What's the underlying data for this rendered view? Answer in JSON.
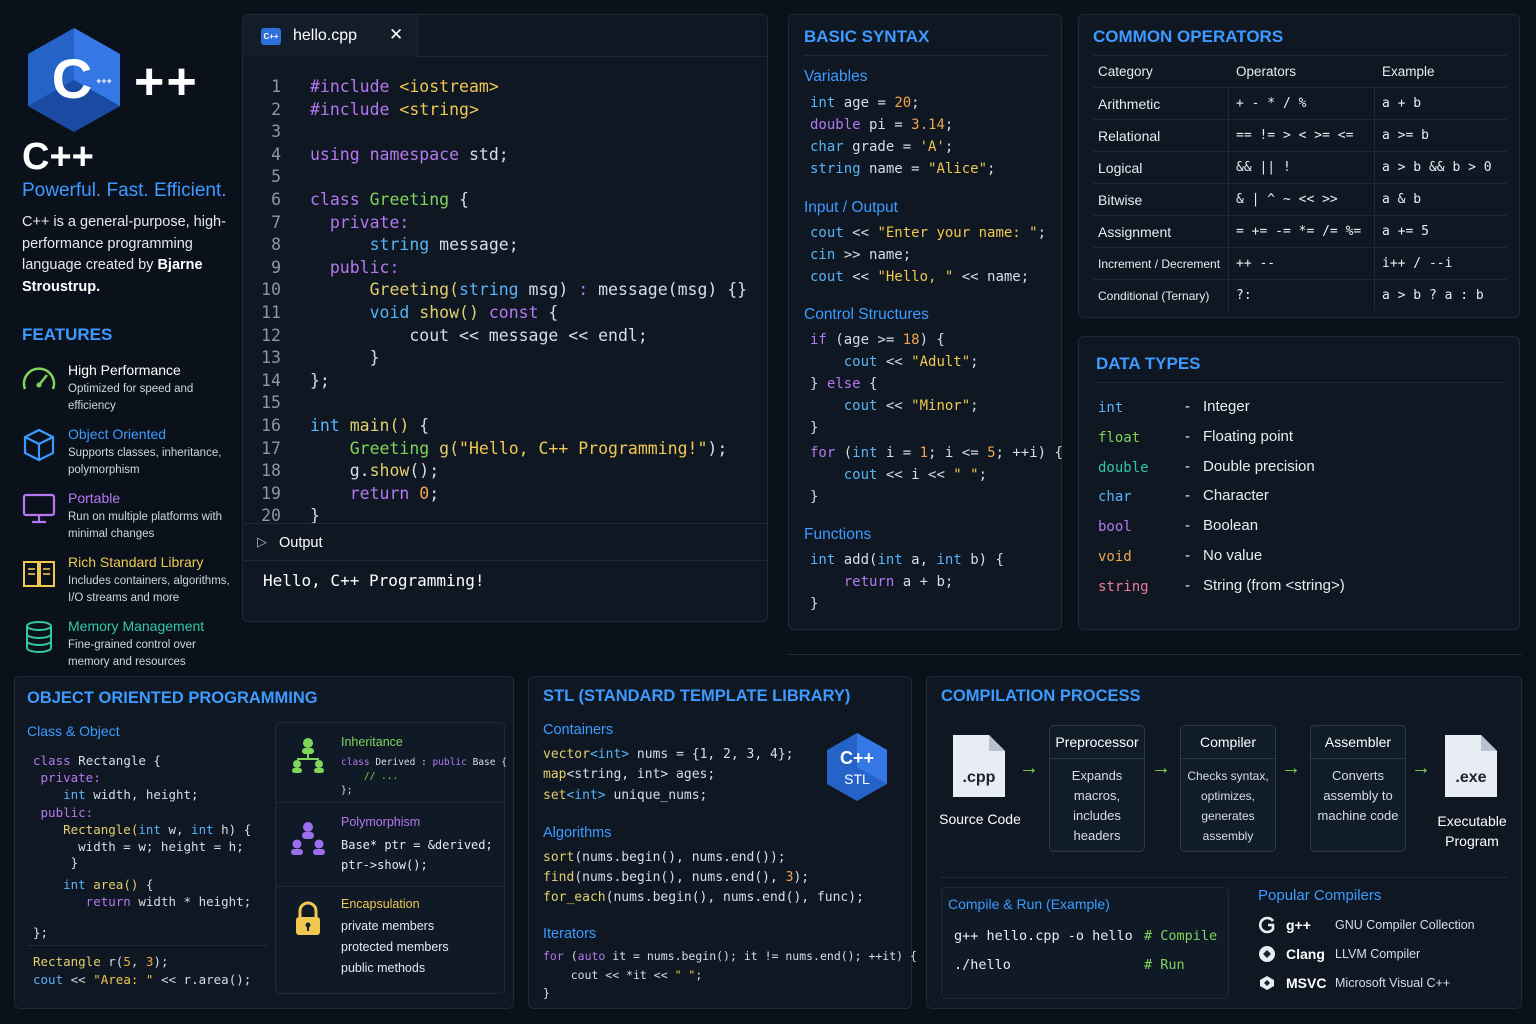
{
  "brand": {
    "plusplus": "++",
    "logo_text": "C",
    "logo_small": "+++",
    "title": "C++",
    "tagline": "Powerful. Fast. Efficient.",
    "intro": "C++ is a general-purpose, high-performance programming language created by",
    "intro_author": "Bjarne Stroustrup."
  },
  "features": {
    "title": "FEATURES",
    "items": [
      {
        "title": "High Performance",
        "desc": "Optimized for speed and efficiency",
        "color": "#7fd65a",
        "icon": "speedometer-icon"
      },
      {
        "title": "Object Oriented",
        "desc": "Supports classes, inheritance, polymorphism",
        "color": "#3d9bff",
        "icon": "cube-icon"
      },
      {
        "title": "Portable",
        "desc": "Run on multiple platforms with minimal changes",
        "color": "#b678f0",
        "icon": "monitor-icon"
      },
      {
        "title": "Rich Standard Library",
        "desc": "Includes containers, algorithms, I/O streams and more",
        "color": "#f0c850",
        "icon": "book-icon"
      },
      {
        "title": "Memory Management",
        "desc": "Fine-grained control over memory and resources",
        "color": "#34c7a5",
        "icon": "database-icon"
      }
    ]
  },
  "editor": {
    "tab_icon": "C++",
    "tab_name": "hello.cpp",
    "close_symbol": "✕",
    "line_numbers": [
      "1",
      "2",
      "3",
      "4",
      "5",
      "6",
      "7",
      "8",
      "9",
      "10",
      "11",
      "12",
      "13",
      "14",
      "15",
      "16",
      "17",
      "18",
      "19",
      "20"
    ],
    "code": {
      "l1a": "#include",
      "l1b": " <iostream>",
      "l2a": "#include",
      "l2b": " <string>",
      "l4a": "using",
      "l4b": " namespace",
      "l4c": " std;",
      "l6a": "class",
      "l6b": " Greeting",
      "l6c": " {",
      "l7": "  private:",
      "l8a": "      string",
      "l8b": " message;",
      "l9": "  public:",
      "l10a": "      Greeting(",
      "l10b": "string",
      "l10c": " msg)",
      "l10d": " :",
      "l10e": " message(msg) {}",
      "l11a": "      void",
      "l11b": " show()",
      "l11c": " const",
      "l11d": " {",
      "l12": "          cout << message << endl;",
      "l13": "      }",
      "l14": "};",
      "l16a": "int",
      "l16b": " main()",
      "l16c": " {",
      "l17a": "    Greeting",
      "l17b": " g(",
      "l17c": "\"Hello, C++ Programming!\"",
      "l17d": ");",
      "l18a": "    g.",
      "l18b": "show",
      "l18c": "();",
      "l19a": "    return",
      "l19b": " 0",
      "l19c": ";",
      "l20": "}"
    },
    "output_label": "Output",
    "output_text": "Hello, C++ Programming!"
  },
  "syntax": {
    "title": "BASIC SYNTAX",
    "variables_h": "Variables",
    "v1a": "int",
    "v1b": " age = ",
    "v1c": "20",
    "v1d": ";",
    "v2a": "double",
    "v2b": " pi = ",
    "v2c": "3.14",
    "v2d": ";",
    "v3a": "char",
    "v3b": " grade = ",
    "v3c": "'A'",
    "v3d": ";",
    "v4a": "string",
    "v4b": " name = ",
    "v4c": "\"Alice\"",
    "v4d": ";",
    "io_h": "Input / Output",
    "io1a": "cout",
    "io1b": " << ",
    "io1c": "\"Enter your name: \"",
    "io1d": ";",
    "io2a": "cin",
    "io2b": " >> name;",
    "io3a": "cout",
    "io3b": " << ",
    "io3c": "\"Hello, \"",
    "io3d": " << name;",
    "ctrl_h": "Control Structures",
    "c1a": "if",
    "c1b": " (age >= ",
    "c1c": "18",
    "c1d": ") {",
    "c2a": "    cout",
    "c2b": " << ",
    "c2c": "\"Adult\"",
    "c2d": ";",
    "c3a": "} ",
    "c3b": "else",
    "c3c": " {",
    "c4a": "    cout",
    "c4b": " << ",
    "c4c": "\"Minor\"",
    "c4d": ";",
    "c5": "}",
    "c6a": "for",
    "c6b": " (",
    "c6c": "int",
    "c6d": " i = ",
    "c6e": "1",
    "c6f": "; i <= ",
    "c6g": "5",
    "c6h": "; ++i) {",
    "c7a": "    cout",
    "c7b": " << i << ",
    "c7c": "\" \"",
    "c7d": ";",
    "c8": "}",
    "fn_h": "Functions",
    "f1a": "int",
    "f1b": " add(",
    "f1c": "int",
    "f1d": " a, ",
    "f1e": "int",
    "f1f": " b) {",
    "f2a": "    return",
    "f2b": " a + b;",
    "f3": "}"
  },
  "operators": {
    "title": "COMMON OPERATORS",
    "headers": [
      "Category",
      "Operators",
      "Example"
    ],
    "rows": [
      [
        "Arithmetic",
        "+ - * / %",
        "a + b"
      ],
      [
        "Relational",
        "== != > < >= <=",
        "a >= b"
      ],
      [
        "Logical",
        "&& || !",
        "a > b && b > 0"
      ],
      [
        "Bitwise",
        "& | ^ ~ << >>",
        "a & b"
      ],
      [
        "Assignment",
        "= += -= *= /= %=",
        "a += 5"
      ],
      [
        "Increment / Decrement",
        "++ --",
        "i++ / --i"
      ],
      [
        "Conditional (Ternary)",
        "?:",
        "a > b ? a : b"
      ]
    ]
  },
  "datatypes": {
    "title": "DATA TYPES",
    "dash": "-",
    "rows": [
      {
        "k": "int",
        "v": "Integer",
        "color": "#59b4f5"
      },
      {
        "k": "float",
        "v": "Floating point",
        "color": "#7fd65a"
      },
      {
        "k": "double",
        "v": "Double precision",
        "color": "#34c7a5"
      },
      {
        "k": "char",
        "v": "Character",
        "color": "#59b4f5"
      },
      {
        "k": "bool",
        "v": "Boolean",
        "color": "#b678f0"
      },
      {
        "k": "void",
        "v": "No value",
        "color": "#f0a550"
      },
      {
        "k": "string",
        "v": "String (from <string>)",
        "color": "#f07a9a"
      }
    ]
  },
  "oop": {
    "title": "OBJECT ORIENTED PROGRAMMING",
    "sub": "Class & Object",
    "o1a": "class",
    "o1b": " Rectangle",
    "o1c": " {",
    "o2": " private:",
    "o3a": "    int",
    "o3b": " width, height;",
    "o4": " public:",
    "o5a": "    Rectangle(",
    "o5b": "int",
    "o5c": " w, ",
    "o5d": "int",
    "o5e": " h) {",
    "o6": "      width = w; height = h;",
    "o7": "     }",
    "o8a": "    int",
    "o8b": " area()",
    "o8c": " {",
    "o9a": "       return",
    "o9b": " width * height;",
    "o10": "};",
    "o11a": "Rectangle",
    "o11b": " r(",
    "o11c": "5",
    "o11d": ", ",
    "o11e": "3",
    "o11f": ");",
    "o12a": "cout",
    "o12b": " << ",
    "o12c": "\"Area: \"",
    "o12d": " << r.area();",
    "inh_title": "Inheritance",
    "inh1a": "class",
    "inh1b": " Derived",
    "inh1c": " : ",
    "inh1d": "public",
    "inh1e": " Base {",
    "inh2": "    // ...",
    "inh3": "};",
    "poly_title": "Polymorphism",
    "poly1": "Base* ptr = &derived;",
    "poly2": "ptr->show();",
    "enc_title": "Encapsulation",
    "enc1": "private members",
    "enc2": "protected members",
    "enc3": "public methods"
  },
  "stl": {
    "title": "STL (STANDARD TEMPLATE LIBRARY)",
    "badge_top": "C++",
    "badge_bottom": "STL",
    "containers_h": "Containers",
    "s1a": "vector",
    "s1b": "<int>",
    "s1c": " nums = {",
    "s1d": "1, 2, 3, 4",
    "s1e": "};",
    "s2a": "map",
    "s2b": "<string, int>",
    "s2c": " ages;",
    "s3a": "set",
    "s3b": "<int>",
    "s3c": " unique_nums;",
    "algo_h": "Algorithms",
    "a1a": "sort",
    "a1b": "(nums.begin(), nums.end());",
    "a2a": "find",
    "a2b": "(nums.begin(), nums.end(), ",
    "a2c": "3",
    "a2d": ");",
    "a3a": "for_each",
    "a3b": "(nums.begin(), nums.end(), func);",
    "iter_h": "Iterators",
    "i1a": "for",
    "i1b": " (",
    "i1c": "auto",
    "i1d": " it = nums.begin(); it != nums.end(); ++it) {",
    "i2a": "    cout << *it << ",
    "i2b": "\" \"",
    "i2c": ";",
    "i3": "}"
  },
  "compile": {
    "title": "COMPILATION PROCESS",
    "src_ext": ".cpp",
    "src_label": "Source Code",
    "exe_ext": ".exe",
    "exe_label": "Executable Program",
    "arrow": "→",
    "stages": [
      {
        "title": "Preprocessor",
        "body": "Expands macros, includes headers"
      },
      {
        "title": "Compiler",
        "body": "Checks syntax, optimizes, generates assembly"
      },
      {
        "title": "Assembler",
        "body": "Converts assembly to machine code"
      }
    ],
    "run_title": "Compile & Run (Example)",
    "run1": "g++ hello.cpp -o hello",
    "run1c": "# Compile",
    "run2": "./hello",
    "run2c": "# Run",
    "compilers_title": "Popular Compilers",
    "compilers": [
      {
        "name": "g++",
        "desc": "GNU Compiler Collection"
      },
      {
        "name": "Clang",
        "desc": "LLVM Compiler"
      },
      {
        "name": "MSVC",
        "desc": "Microsoft Visual C++"
      }
    ]
  },
  "colors": {
    "accent": "#3d9bff",
    "background": "#0b111b",
    "panel": "#0f1722",
    "keyword": "#b678f0",
    "type": "#59b4f5",
    "string": "#f0c850",
    "class": "#7fd65a"
  }
}
